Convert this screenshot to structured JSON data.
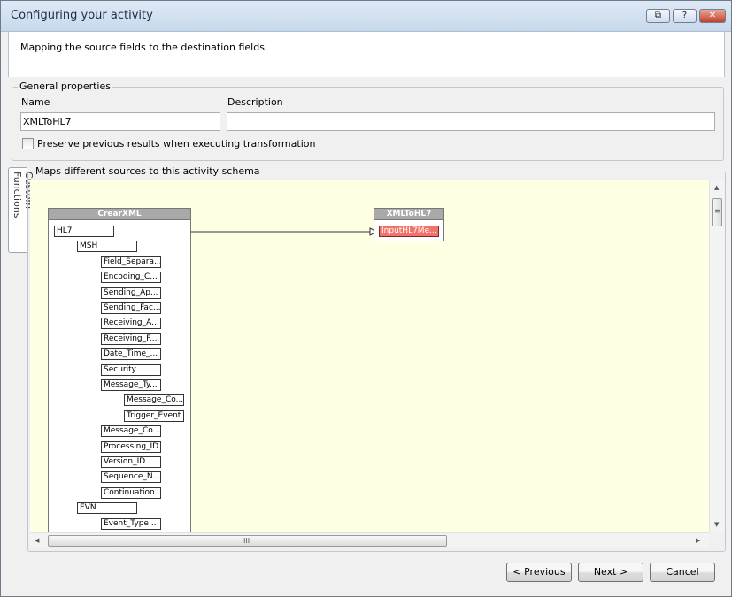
{
  "window": {
    "title": "Configuring your activity"
  },
  "titlebar_buttons": [
    {
      "name": "restore",
      "glyph": "⧉"
    },
    {
      "name": "help",
      "glyph": "?"
    },
    {
      "name": "close",
      "glyph": "✕"
    }
  ],
  "header": {
    "text": "Mapping the source fields to the destination fields."
  },
  "general": {
    "legend": "General properties",
    "name_label": "Name",
    "name_value": "XMLToHL7",
    "description_label": "Description",
    "description_value": "",
    "preserve_label": "Preserve previous results when executing transformation"
  },
  "side_tab": {
    "label": "Custom Functions"
  },
  "maps": {
    "legend": "Maps different sources to this activity schema",
    "source": {
      "title": "CrearXML",
      "nodes": [
        "HL7",
        "MSH",
        "Field_Separa...",
        "Encoding_C...",
        "Sending_Ap...",
        "Sending_Fac...",
        "Receiving_A...",
        "Receiving_F...",
        "Date_Time_...",
        "Security",
        "Message_Ty...",
        "Message_Co...",
        "Trigger_Event",
        "Message_Co...",
        "Processing_ID",
        "Version_ID",
        "Sequence_N...",
        "Continuation...",
        "EVN",
        "Event_Type..."
      ]
    },
    "target": {
      "title": "XMLToHL7",
      "node": "InputHL7Me..."
    }
  },
  "scrollbars": {
    "h_grip": "III",
    "v_grip": "≡"
  },
  "buttons": {
    "previous": "< Previous",
    "next": "Next >",
    "cancel": "Cancel"
  }
}
